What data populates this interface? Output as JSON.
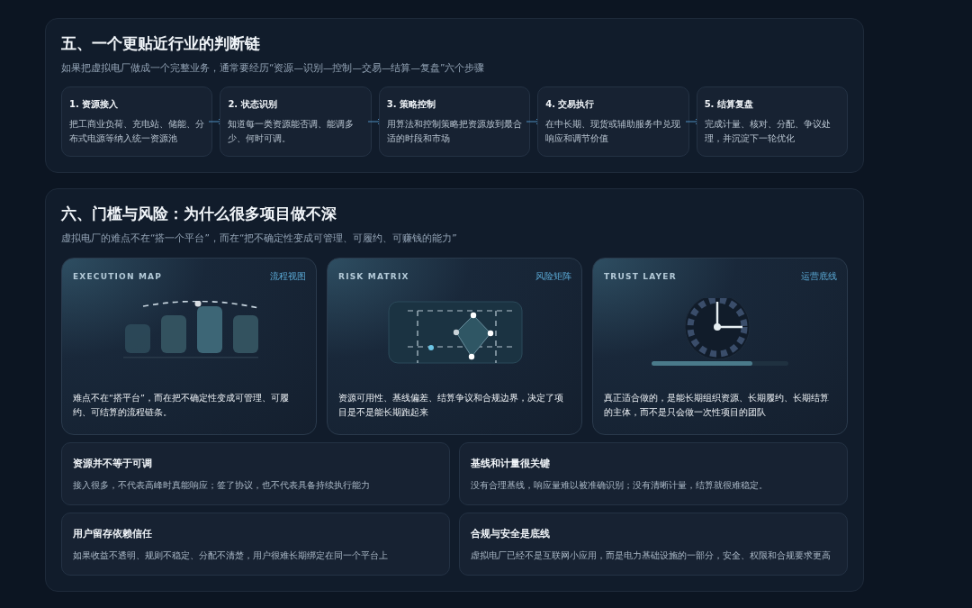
{
  "section_chain": {
    "title": "五、一个更贴近行业的判断链",
    "subtitle": "如果把虚拟电厂做成一个完整业务，通常要经历“资源—识别—控制—交易—结算—复盘”六个步骤",
    "steps": [
      {
        "title": "1. 资源接入",
        "text": "把工商业负荷、充电站、储能、分布式电源等纳入统一资源池"
      },
      {
        "title": "2. 状态识别",
        "text": "知道每一类资源能否调、能调多少、何时可调。"
      },
      {
        "title": "3. 策略控制",
        "text": "用算法和控制策略把资源放到最合适的时段和市场"
      },
      {
        "title": "4. 交易执行",
        "text": "在中长期、现货或辅助服务中兑现响应和调节价值"
      },
      {
        "title": "5. 结算复盘",
        "text": "完成计量、核对、分配、争议处理，并沉淀下一轮优化"
      }
    ]
  },
  "section_risk": {
    "title": "六、门槛与风险：为什么很多项目做不深",
    "subtitle": "虚拟电厂的难点不在“搭一个平台”，而在“把不确定性变成可管理、可履约、可赚钱的能力”",
    "visual_cards": [
      {
        "kind": "map",
        "label": "EXECUTION MAP",
        "tag": "流程视图",
        "text": "难点不在“搭平台”，而在把不确定性变成可管理、可履约、可结算的流程链条。"
      },
      {
        "kind": "matrix",
        "label": "RISK MATRIX",
        "tag": "风险矩阵",
        "text": "资源可用性、基线偏差、结算争议和合规边界，决定了项目是不是能长期跑起来"
      },
      {
        "kind": "clock",
        "label": "TRUST LAYER",
        "tag": "运营底线",
        "text": "真正适合做的，是能长期组织资源、长期履约、长期结算的主体，而不是只会做一次性项目的团队"
      }
    ],
    "points": [
      {
        "title": "资源并不等于可调",
        "text": "接入很多，不代表高峰时真能响应；签了协议，也不代表具备持续执行能力"
      },
      {
        "title": "基线和计量很关键",
        "text": "没有合理基线，响应量难以被准确识别；没有清晰计量，结算就很难稳定。"
      },
      {
        "title": "用户留存依赖信任",
        "text": "如果收益不透明、规则不稳定、分配不清楚，用户很难长期绑定在同一个平台上"
      },
      {
        "title": "合规与安全是底线",
        "text": "虚拟电厂已经不是互联网小应用，而是电力基础设施的一部分，安全、权限和合规要求更高"
      }
    ]
  }
}
